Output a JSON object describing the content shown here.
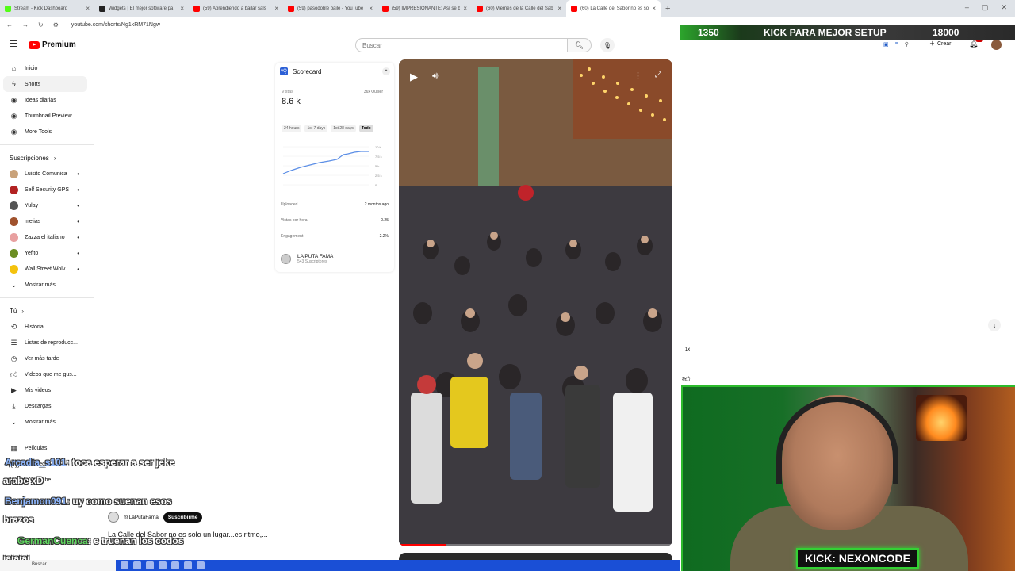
{
  "browser": {
    "tabs": [
      {
        "title": "Stream - Kick Dashboard",
        "color": "#53fc18",
        "active": false
      },
      {
        "title": "Widgets | El mejor software pa",
        "color": "#222222",
        "active": false
      },
      {
        "title": "(59) Aprendiendo a bailar sals",
        "color": "#ff0000",
        "active": false
      },
      {
        "title": "(59) pasodoble baile - YouTube",
        "color": "#ff0000",
        "active": false
      },
      {
        "title": "(59) IMPRESIONANTE: Así se ba",
        "color": "#ff0000",
        "active": false
      },
      {
        "title": "(60) Viernes de la Calle del Sab",
        "color": "#ff0000",
        "active": false
      },
      {
        "title": "(60) La Calle del Sabor no es sol",
        "color": "#ff0000",
        "active": true
      }
    ],
    "url": "youtube.com/shorts/Ng1kRM71Ngw",
    "new_tab": "+"
  },
  "header": {
    "logo_text": "Premium",
    "search_placeholder": "Buscar",
    "create_label": "Crear",
    "notification_badge": "9+"
  },
  "sidebar": {
    "main": [
      {
        "label": "Inicio",
        "icon": "home-icon"
      },
      {
        "label": "Shorts",
        "icon": "shorts-icon",
        "active": true
      },
      {
        "label": "Ideas diarias",
        "icon": "ext-icon"
      },
      {
        "label": "Thumbnail Preview",
        "icon": "ext-icon"
      },
      {
        "label": "More Tools",
        "icon": "ext-icon"
      }
    ],
    "subs_heading": "Suscripciones",
    "subscriptions": [
      {
        "label": "Luisito Comunica",
        "color": "#c9a27a"
      },
      {
        "label": "Self Security GPS",
        "color": "#b22222"
      },
      {
        "label": "Yulay",
        "color": "#555555"
      },
      {
        "label": "melias",
        "color": "#a0522d"
      },
      {
        "label": "Zazza el italiano",
        "color": "#e8a0a0"
      },
      {
        "label": "Yefito",
        "color": "#6b8e23"
      },
      {
        "label": "Wall Street Wolv...",
        "color": "#f4c20d"
      }
    ],
    "show_more": "Mostrar más",
    "you_heading": "Tú",
    "you_items": [
      {
        "label": "Historial",
        "icon": "history-icon"
      },
      {
        "label": "Listas de reproducc...",
        "icon": "playlist-icon"
      },
      {
        "label": "Ver más tarde",
        "icon": "clock-icon"
      },
      {
        "label": "Videos que me gus...",
        "icon": "like-icon"
      },
      {
        "label": "Mis videos",
        "icon": "video-icon"
      },
      {
        "label": "Descargas",
        "icon": "download-icon"
      }
    ],
    "show_more_2": "Mostrar más",
    "explore_items": [
      {
        "label": "Películas"
      },
      {
        "label": "En directo"
      }
    ],
    "more_youtube": "Más de YouTube"
  },
  "scorecard": {
    "title": "Scorecard",
    "views_label": "Vistas",
    "views": "8.6 k",
    "outlier": "36x Outlier",
    "tabs": [
      "24 hours",
      "1st 7 days",
      "1st 28 days",
      "Todo"
    ],
    "active_tab": "Todo",
    "y_ticks": [
      "10 k",
      "7.5 k",
      "5 k",
      "2.5 k",
      "0"
    ],
    "rows": [
      {
        "label": "Uploaded",
        "value": "2 months ago"
      },
      {
        "label": "Vistas por hora",
        "value": "0.25"
      },
      {
        "label": "Engagement",
        "value": "2.2%"
      }
    ],
    "channel_name": "LA PUTA FAMA",
    "channel_subs": "543 Suscriptores"
  },
  "video": {
    "channel_handle": "@LaPutaFama",
    "subscribe_label": "Suscribirme",
    "title": "La Calle del Sabor no es solo un lugar...es ritmo,...",
    "progress": 0.17,
    "playback_rate": "1x"
  },
  "stream": {
    "goal_current": "1350",
    "goal_text": "KICK PARA MEJOR SETUP",
    "goal_target": "18000",
    "cam_label": "KICK: NEXONCODE"
  },
  "chat": [
    {
      "user": "Arcadia_s101",
      "message": ": toca esperar a ser jeke",
      "user_color": "blue"
    },
    {
      "user": "",
      "message": "arabe xD",
      "user_color": "blue"
    },
    {
      "user": "Benjamon091",
      "message": ": uy como suenan esos",
      "user_color": "blue"
    },
    {
      "user": "",
      "message": "brazos",
      "user_color": "blue"
    },
    {
      "user": "GermanCuenca",
      "message": ": e truenan los codos",
      "user_color": "green"
    },
    {
      "user": "",
      "message": "jajajaj",
      "user_color": "blue"
    }
  ],
  "taskbar": {
    "search_label": "Buscar"
  },
  "colors": {
    "youtube_red": "#ff0000",
    "kick_green": "#53fc18",
    "scorecard_blue": "#2b5fd6"
  }
}
